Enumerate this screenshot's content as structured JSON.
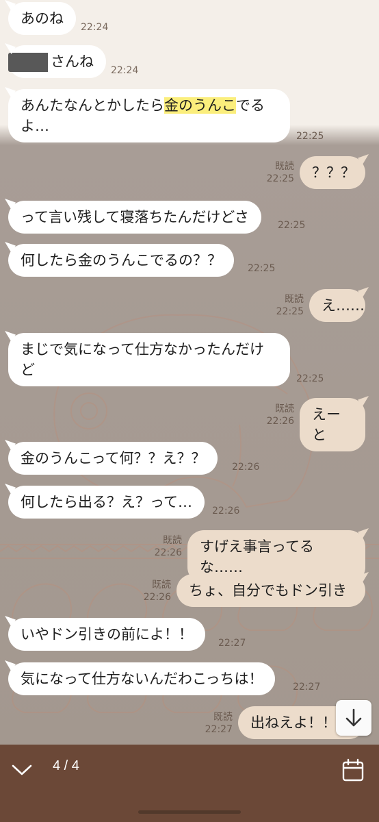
{
  "messages": [
    {
      "text": "あのね",
      "time": "22:24"
    },
    {
      "text": "さんね",
      "time": "22:24"
    },
    {
      "text_before": "あんたなんとかしたら",
      "text_highlight": "金のうんこ",
      "text_after": "でる\nよ…",
      "time": "22:25"
    },
    {
      "read": "既読",
      "text": "？？？",
      "time": "22:25"
    },
    {
      "text": "って言い残して寝落ちたんだけどさ",
      "time": "22:25"
    },
    {
      "text": "何したら金のうんこでるの？？",
      "time": "22:25"
    },
    {
      "read": "既読",
      "text": "え……",
      "time": "22:25"
    },
    {
      "text": "まじで気になって仕方なかったんだけ\nど",
      "time": "22:25"
    },
    {
      "read": "既読",
      "text": "えーと",
      "time": "22:26"
    },
    {
      "text": "金のうんこって何？？え？？",
      "time": "22:26"
    },
    {
      "text": "何したら出る？え？って…",
      "time": "22:26"
    },
    {
      "read": "既読",
      "text": "すげえ事言ってるな……",
      "time": "22:26"
    },
    {
      "read": "既読",
      "text": "ちょ、自分でもドン引き",
      "time": "22:26"
    },
    {
      "text": "いやドン引きの前によ！！",
      "time": "22:27"
    },
    {
      "text": "気になって仕方ないんだわこっちは！",
      "time": "22:27"
    },
    {
      "read": "既読",
      "text": "出ねえよ！！",
      "time": "22:27"
    }
  ],
  "bottom_bar": {
    "counter": "4 / 4",
    "collapse_icon": "chevron-down-icon",
    "calendar_icon": "calendar-icon"
  },
  "scroll_icon": "arrow-down-icon",
  "colors": {
    "incoming_bubble": "#ffffff",
    "outgoing_bubble": "#ecdccb",
    "highlight": "#fbee7c",
    "bottom_bar": "#6b4837",
    "chat_background": "#a69a93"
  }
}
